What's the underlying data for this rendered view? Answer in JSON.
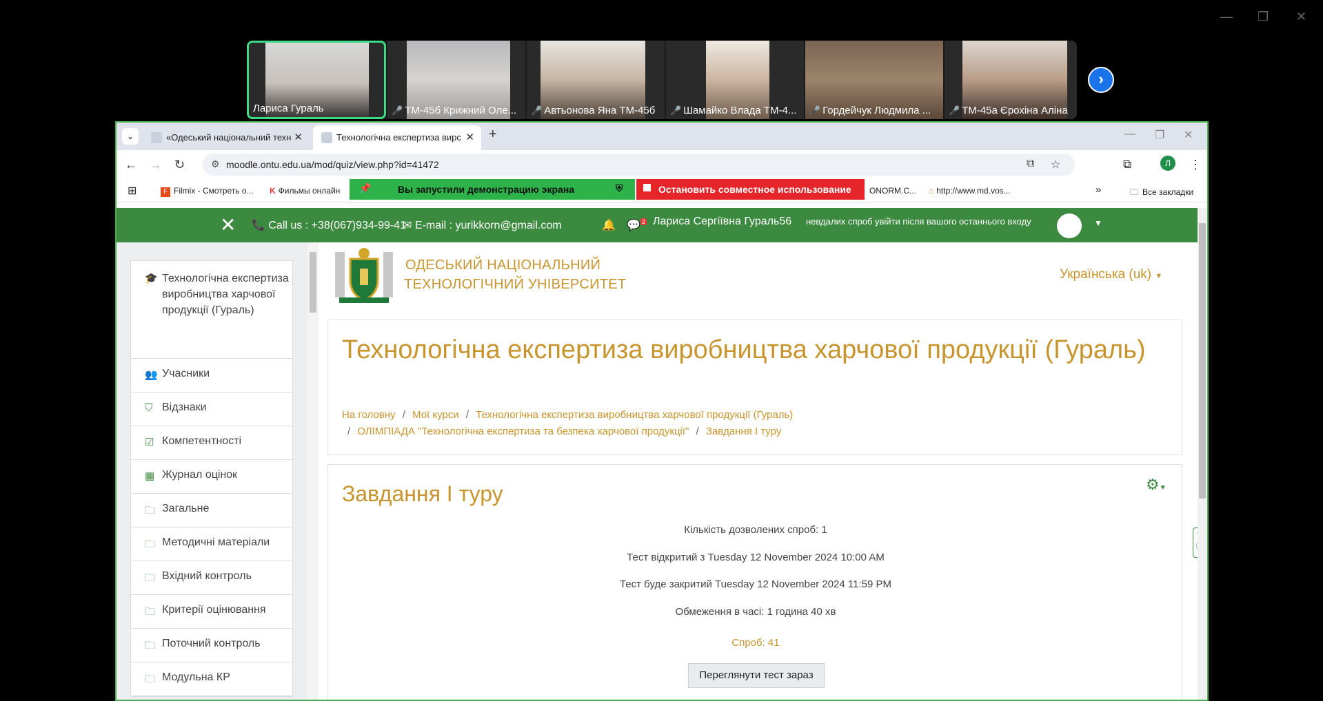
{
  "video": {
    "participants": [
      {
        "name": "Лариса Гураль",
        "muted": false
      },
      {
        "name": "ТМ-45б Крижний Оле...",
        "muted": true
      },
      {
        "name": "Автьонова Яна ТМ-45б",
        "muted": true
      },
      {
        "name": "Шамайко Влада ТМ-4...",
        "muted": true
      },
      {
        "name": "Гордейчук Людмила ...",
        "muted": true
      },
      {
        "name": "ТМ-45а Єрохіна Аліна",
        "muted": true
      }
    ]
  },
  "browser": {
    "tabs": [
      {
        "title": "«Одеський національний техн"
      },
      {
        "title": "Технологічна експертиза вирс"
      }
    ],
    "url": "moodle.ontu.edu.ua/mod/quiz/view.php?id=41472",
    "profile_initial": "Л",
    "bookmarks": {
      "b1": "Filmix - Смотреть о...",
      "b2": "Фильмы онлайн",
      "b3": "ONORM.C...",
      "b4": "http://www.md.vos...",
      "all": "Все закладки"
    },
    "share_banner": "Вы запустили демонстрацию экрана",
    "stop_share": "Остановить совместное использование"
  },
  "topbar": {
    "phone": "Call us : +38(067)934-99-41",
    "email": "E-mail : yurikkorn@gmail.com",
    "badge": "2",
    "user": "Лариса Сергіївна Гураль56",
    "login_note": "невдалих спроб увійти після вашого останнього входу"
  },
  "logo": {
    "line1": "ОДЕСЬКИЙ НАЦІОНАЛЬНИЙ",
    "line2": "ТЕХНОЛОГІЧНИЙ УНІВЕРСИТЕТ"
  },
  "language": "Українська (uk)",
  "nav": [
    {
      "label": "Технологічна експертиза виробництва харчової продукції (Гураль)",
      "icon": "🎓"
    },
    {
      "label": "Учасники",
      "icon": "👥"
    },
    {
      "label": "Відзнаки",
      "icon": "⛉"
    },
    {
      "label": "Компетентності",
      "icon": "☑"
    },
    {
      "label": "Журнал оцінок",
      "icon": "▦"
    },
    {
      "label": "Загальне",
      "icon": "🗀"
    },
    {
      "label": "Методичні матеріали",
      "icon": "🗀"
    },
    {
      "label": "Вхідний контроль",
      "icon": "🗀"
    },
    {
      "label": "Критерії оцінювання",
      "icon": "🗀"
    },
    {
      "label": "Поточний контроль",
      "icon": "🗀"
    },
    {
      "label": "Модульна КР",
      "icon": "🗀"
    }
  ],
  "course": {
    "title": "Технологічна експертиза виробництва харчової продукції (Гураль)",
    "breadcrumb": {
      "home": "На головну",
      "courses": "Мої курси",
      "course": "Технологічна експертиза виробництва харчової продукції (Гураль)",
      "section": "ОЛІМПІАДА \"Технологічна експертиза та безпека харчової продукції\"",
      "activity": "Завдання I туру"
    }
  },
  "quiz": {
    "title": "Завдання I туру",
    "attempts_allowed": "Кількість дозволених спроб: 1",
    "opens": "Тест відкритий з Tuesday 12 November 2024 10:00 AM",
    "closes": "Тест буде закритий Tuesday 12 November 2024 11:59 PM",
    "time_limit": "Обмеження в часі: 1 година 40 хв",
    "attempts_link": "Спроб: 41",
    "preview_button": "Переглянути тест зараз"
  }
}
